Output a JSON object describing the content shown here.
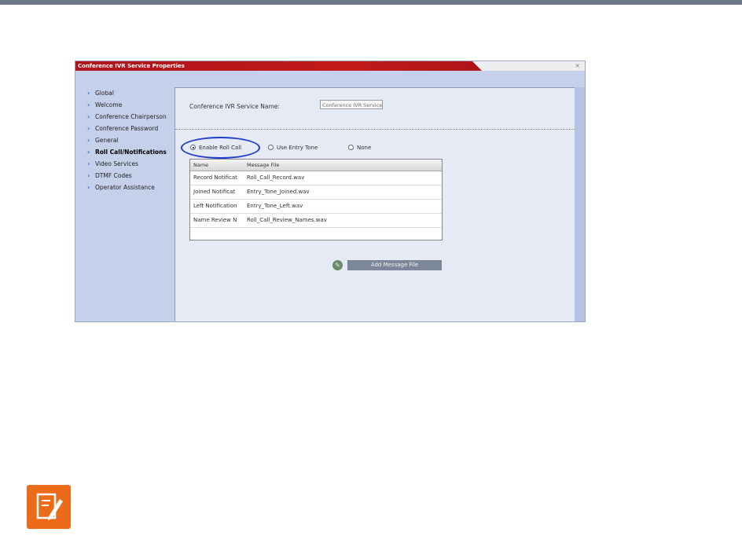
{
  "dialog": {
    "title": "Conference IVR Service Properties",
    "close_glyph": "×"
  },
  "sidebar": {
    "items": [
      {
        "label": "Global"
      },
      {
        "label": "Welcome"
      },
      {
        "label": "Conference Chairperson"
      },
      {
        "label": "Conference Password"
      },
      {
        "label": "General"
      },
      {
        "label": "Roll Call/Notifications",
        "active": true
      },
      {
        "label": "Video Services"
      },
      {
        "label": "DTMF Codes"
      },
      {
        "label": "Operator Assistance"
      }
    ]
  },
  "main": {
    "service_name_label": "Conference IVR Service Name:",
    "service_name_value": "Conference IVR Service",
    "radio": {
      "enable_roll_call": "Enable Roll Call",
      "use_entry_tone": "Use Entry Tone",
      "none": "None",
      "selected": "enable_roll_call"
    },
    "table": {
      "headers": [
        "Name",
        "Message File"
      ],
      "rows": [
        [
          "Record Notificat",
          "Roll_Call_Record.wav"
        ],
        [
          "Joined Notificat",
          "Entry_Tone_Joined.wav"
        ],
        [
          "Left Notification",
          "Entry_Tone_Left.wav"
        ],
        [
          "Name Review N",
          "Roll_Call_Review_Names.wav"
        ]
      ]
    },
    "add_message_button": "Add Message File"
  },
  "colors": {
    "titlebar": "#b1131d",
    "highlight_ellipse": "#1f3ccd",
    "note_icon": "#ec6b1a"
  }
}
